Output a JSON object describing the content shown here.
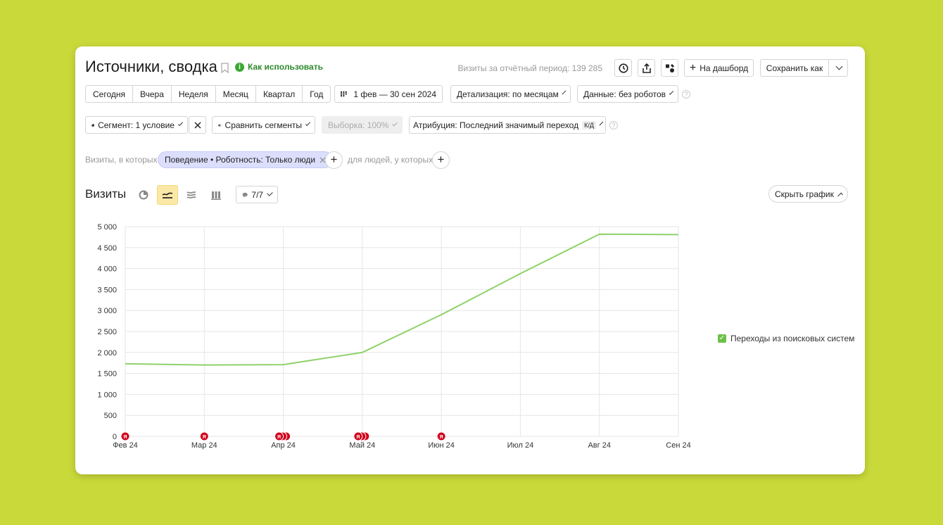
{
  "header": {
    "title": "Источники, сводка",
    "howto_label": "Как использовать",
    "visits_total": "Визиты за отчётный период: 139 285",
    "dashboard_label": "На дашборд",
    "save_as_label": "Сохранить как"
  },
  "periods": [
    "Сегодня",
    "Вчера",
    "Неделя",
    "Месяц",
    "Квартал",
    "Год"
  ],
  "date_range": "1 фев — 30 сен 2024",
  "detail": "Детализация: по месяцам",
  "data_filter": "Данные: без роботов",
  "segment": "Сегмент: 1 условие",
  "compare": "Сравнить сегменты",
  "sample": "Выборка: 100%",
  "attribution": "Атрибуция: Последний значимый переход",
  "attribution_badge": "К/Д",
  "filters": {
    "prefix": "Визиты, в которых",
    "chip": "Поведение • Роботность: Только люди",
    "people": "для людей, у которых"
  },
  "chart_section": {
    "title": "Визиты",
    "series_count": "7/7",
    "hide_label": "Скрыть график"
  },
  "colors": {
    "line": "#8fd16a",
    "marker": "#d0021b",
    "accent": "#fce8a6"
  },
  "chart_data": {
    "type": "line",
    "categories": [
      "Фев 24",
      "Мар 24",
      "Апр 24",
      "Май 24",
      "Июн 24",
      "Июл 24",
      "Авг 24",
      "Сен 24"
    ],
    "y_ticks": [
      "0",
      "500",
      "1 000",
      "1 500",
      "2 000",
      "2 500",
      "3 000",
      "3 500",
      "4 000",
      "4 500",
      "5 000"
    ],
    "ylim": [
      0,
      5000
    ],
    "grid": true,
    "legend_position": "right",
    "series": [
      {
        "name": "Переходы из поисковых систем",
        "values": [
          1730,
          1700,
          1710,
          2000,
          2900,
          3880,
          4820,
          4810
        ]
      }
    ],
    "annotations": [
      {
        "category": "Фев 24",
        "count": 1,
        "label": "Я"
      },
      {
        "category": "Мар 24",
        "count": 1,
        "label": "Я"
      },
      {
        "category": "Апр 24",
        "count": 3,
        "label": "Я"
      },
      {
        "category": "Май 24",
        "count": 3,
        "label": "Я"
      },
      {
        "category": "Июн 24",
        "count": 1,
        "label": "Я"
      }
    ]
  }
}
